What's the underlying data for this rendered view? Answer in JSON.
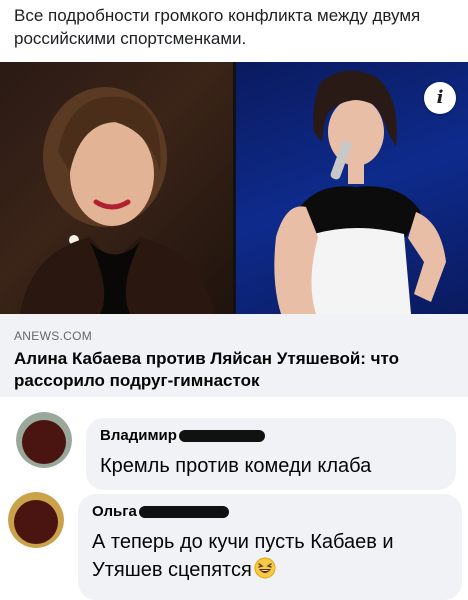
{
  "post": {
    "text": "Все подробности громкого конфликта между двумя российскими спортсменками."
  },
  "link_card": {
    "domain": "ANEWS.COM",
    "title": "Алина Кабаева против Ляйсан Утяшевой: что рассорило подруг-гимнасток",
    "info_icon": "info-icon",
    "info_label": "i"
  },
  "comments": [
    {
      "author": "Владимир",
      "text": "Кремль против комеди клаба",
      "avatar_color": "#4a1410"
    },
    {
      "author": "Ольга",
      "text": "А теперь до кучи пусть Кабаев и Утяшев сцепятся",
      "emoji": "grinning-squinting-face-emoji",
      "avatar_color": "#4a1410"
    }
  ],
  "colors": {
    "bubble_bg": "#f0f2f5",
    "text_primary": "#050505",
    "text_secondary": "#65676b",
    "right_photo_bg": "#0e2b8c"
  }
}
